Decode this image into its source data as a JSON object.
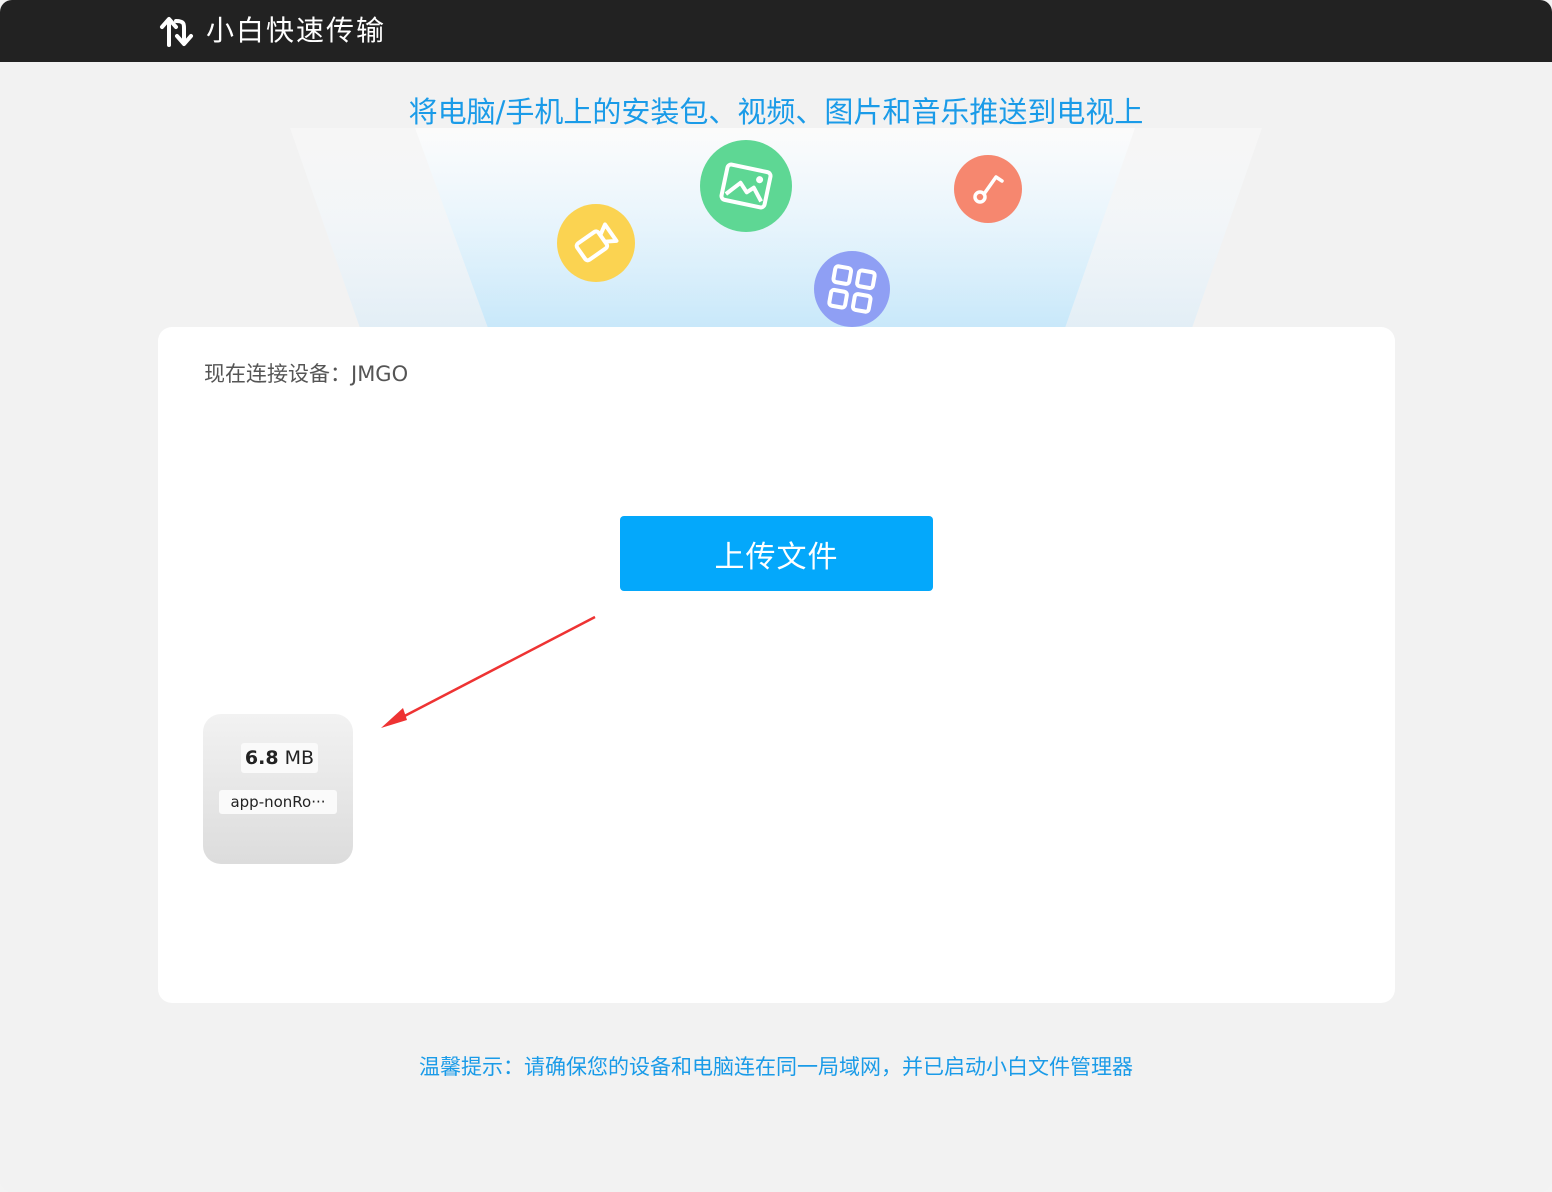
{
  "app": {
    "title": "小白快速传输",
    "logo_icon": "sync-arrows-icon"
  },
  "hero": {
    "tagline": "将电脑/手机上的安装包、视频、图片和音乐推送到电视上",
    "bubbles": [
      {
        "name": "video-icon",
        "color": "#fbd351"
      },
      {
        "name": "image-icon",
        "color": "#5ed794"
      },
      {
        "name": "app-grid-icon",
        "color": "#8f9ff4"
      },
      {
        "name": "music-icon",
        "color": "#f6876f"
      }
    ]
  },
  "panel": {
    "device_label": "现在连接设备：",
    "device_name": "JMGO",
    "upload_label": "上传文件",
    "file": {
      "size_value": "6.8",
      "size_unit": "MB",
      "name": "app-nonRo···"
    }
  },
  "hint": "温馨提示：请确保您的设备和电脑连在同一局域网，并已启动小白文件管理器",
  "colors": {
    "accent": "#04a8fb",
    "text_blue": "#1a9be8",
    "titlebar": "#222222",
    "arrow": "#ee3333"
  }
}
